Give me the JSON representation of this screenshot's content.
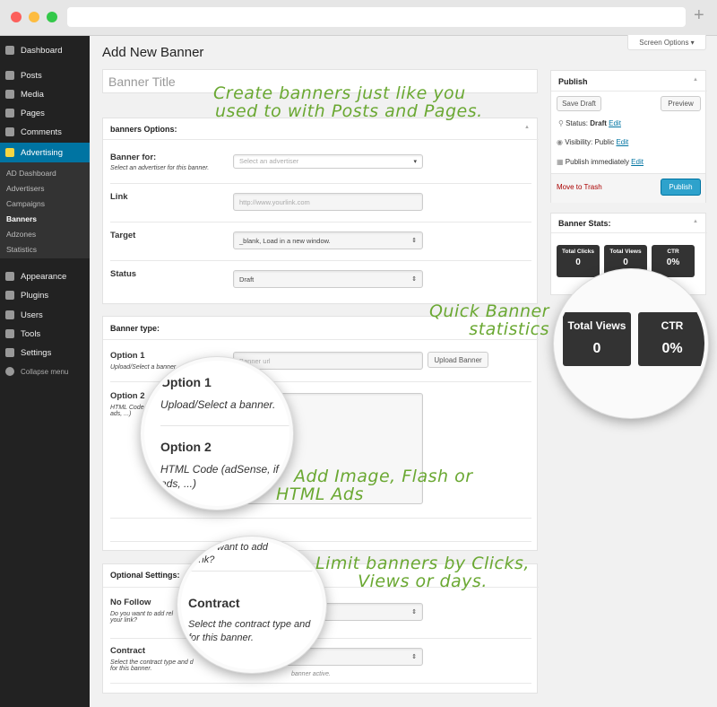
{
  "browser": {
    "new_tab": "+"
  },
  "sidebar": {
    "items": [
      {
        "label": "Dashboard",
        "icon": "dashboard-icon"
      },
      {
        "label": "Posts",
        "icon": "pin-icon"
      },
      {
        "label": "Media",
        "icon": "media-icon"
      },
      {
        "label": "Pages",
        "icon": "pages-icon"
      },
      {
        "label": "Comments",
        "icon": "comment-icon"
      },
      {
        "label": "Advertising",
        "icon": "advertising-icon"
      },
      {
        "label": "Appearance",
        "icon": "brush-icon"
      },
      {
        "label": "Plugins",
        "icon": "plugin-icon"
      },
      {
        "label": "Users",
        "icon": "user-icon"
      },
      {
        "label": "Tools",
        "icon": "wrench-icon"
      },
      {
        "label": "Settings",
        "icon": "settings-icon"
      },
      {
        "label": "Collapse menu",
        "icon": "collapse-icon"
      }
    ],
    "submenu": [
      "AD Dashboard",
      "Advertisers",
      "Campaigns",
      "Banners",
      "Adzones",
      "Statistics"
    ]
  },
  "header": {
    "title": "Add New Banner",
    "screen_options": "Screen Options ▾"
  },
  "title_input": {
    "placeholder": "Banner Title"
  },
  "options": {
    "title": "banners Options:",
    "banner_for": "Banner for:",
    "banner_for_desc": "Select an advertiser for this banner.",
    "advertiser_placeholder": "Select an advertiser",
    "link": "Link",
    "link_placeholder": "http://www.yourlink.com",
    "target": "Target",
    "target_value": "_blank, Load in a new window.",
    "status": "Status",
    "status_value": "Draft"
  },
  "banner_type": {
    "title": "Banner type:",
    "opt1": "Option 1",
    "opt1_desc": "Upload/Select a banner.",
    "url_placeholder": "Banner url",
    "upload": "Upload Banner",
    "opt2": "Option 2",
    "opt2_desc": "HTML Code (adSense, iframe ads, ...)",
    "opt2_desc_short": "HTML Code (",
    "opt2_desc_end": "ads, ...)",
    "mag_opt2_desc": "HTML Code (adSense, if",
    "mag_opt2_end": "ads, ...)"
  },
  "optional": {
    "title": "Optional Settings:",
    "nofollow": "No Follow",
    "nofollow_desc": "Do you want to add rel nofollow to your link?",
    "nofollow_desc_short": "Do you want to add rel",
    "nofollow_desc_end": "your link?",
    "contract": "Contract",
    "contract_desc": "Select the contract type and duration for this banner.",
    "contract_desc_short": "Select the contract type and d",
    "contract_desc_end": "for this banner.",
    "contract_hint": "banner active.",
    "mag_top": "want to add",
    "mag_top2": "r link?",
    "mag_desc": "Select the contract type and",
    "mag_desc2": "for this banner."
  },
  "publish": {
    "title": "Publish",
    "save_draft": "Save Draft",
    "preview": "Preview",
    "status_label": "Status:",
    "status": "Draft",
    "visibility_label": "Visibility:",
    "visibility": "Public",
    "schedule": "Publish immediately",
    "edit": "Edit",
    "trash": "Move to Trash",
    "publish": "Publish"
  },
  "stats": {
    "title": "Banner Stats:",
    "clicks_label": "Total Clicks",
    "clicks": "0",
    "views_label": "Total Views",
    "views": "0",
    "ctr_label": "CTR",
    "ctr": "0%"
  },
  "annotations": {
    "a1": "Create banners just like you",
    "a1b": "used to with Posts and Pages.",
    "a2": "Quick Banner",
    "a2b": "statistics",
    "a3": "Add Image, Flash or",
    "a3b": "HTML Ads",
    "a4": "Limit banners by Clicks,",
    "a4b": "Views or days."
  },
  "colors": {
    "accent": "#0074a2",
    "annotation": "#6aa832",
    "sidebar": "#222222",
    "trash": "#a00000"
  }
}
